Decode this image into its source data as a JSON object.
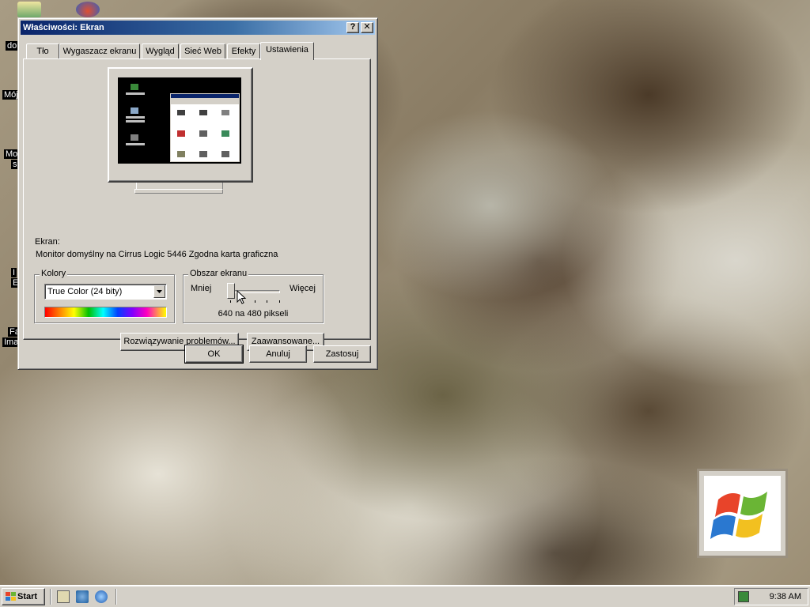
{
  "desktop": {
    "icon_labels": [
      "do",
      "Mój",
      "Mo",
      "s",
      "I",
      "E",
      "Fa",
      "Ima"
    ]
  },
  "window": {
    "title": "Właściwości: Ekran",
    "help_label": "?",
    "close_label": "✕",
    "tabs": [
      {
        "label": "Tło"
      },
      {
        "label": "Wygaszacz ekranu"
      },
      {
        "label": "Wygląd"
      },
      {
        "label": "Sieć Web"
      },
      {
        "label": "Efekty"
      },
      {
        "label": "Ustawienia"
      }
    ],
    "active_tab": "Ustawienia",
    "display_label": "Ekran:",
    "display_value": "Monitor domyślny na Cirrus Logic 5446 Zgodna karta graficzna",
    "colors": {
      "title": "Kolory",
      "selected": "True Color (24 bity)"
    },
    "screen_area": {
      "title": "Obszar ekranu",
      "less": "Mniej",
      "more": "Więcej",
      "value": "640 na 480 pikseli",
      "slider_position": 0
    },
    "troubleshoot_label": "Rozwiązywanie problemów...",
    "advanced_label": "Zaawansowane...",
    "ok_label": "OK",
    "cancel_label": "Anuluj",
    "apply_label": "Zastosuj"
  },
  "taskbar": {
    "start_label": "Start",
    "clock": "9:38 AM"
  },
  "colors": {
    "title_active_start": "#0a246a",
    "title_active_end": "#a6caf0",
    "face": "#d4d0c8"
  }
}
